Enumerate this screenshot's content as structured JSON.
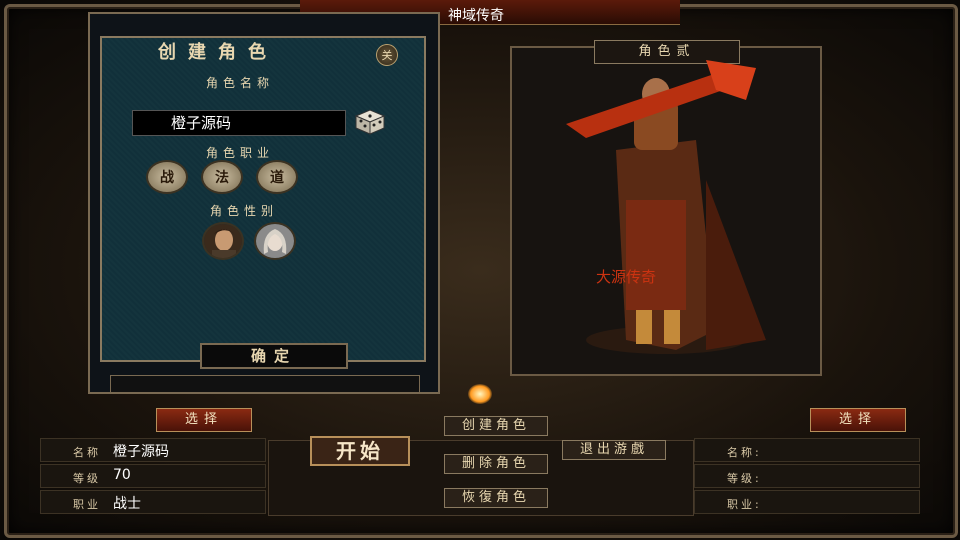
{
  "window": {
    "title": "神域传奇"
  },
  "create_dialog": {
    "title": "创建角色",
    "close_label": "关",
    "name_label": "角色名称",
    "name_value": "橙子源码",
    "class_label": "角色职业",
    "classes": [
      "战",
      "法",
      "道"
    ],
    "gender_label": "角色性别",
    "confirm_label": "确定"
  },
  "character_panel": {
    "tab_label": "角色贰",
    "watermark": "大源传奇"
  },
  "buttons": {
    "select_left": "选择",
    "select_right": "选择",
    "start": "开始",
    "create_role": "创建角色",
    "delete_role": "删除角色",
    "restore_role": "恢復角色",
    "exit_game": "退出游戲"
  },
  "left_info": {
    "name_key": "名称",
    "name_value": "橙子源码",
    "level_key": "等级",
    "level_value": "70",
    "class_key": "职业",
    "class_value": "战士"
  },
  "right_info": {
    "name_key": "名称:",
    "level_key": "等级:",
    "class_key": "职业:"
  }
}
